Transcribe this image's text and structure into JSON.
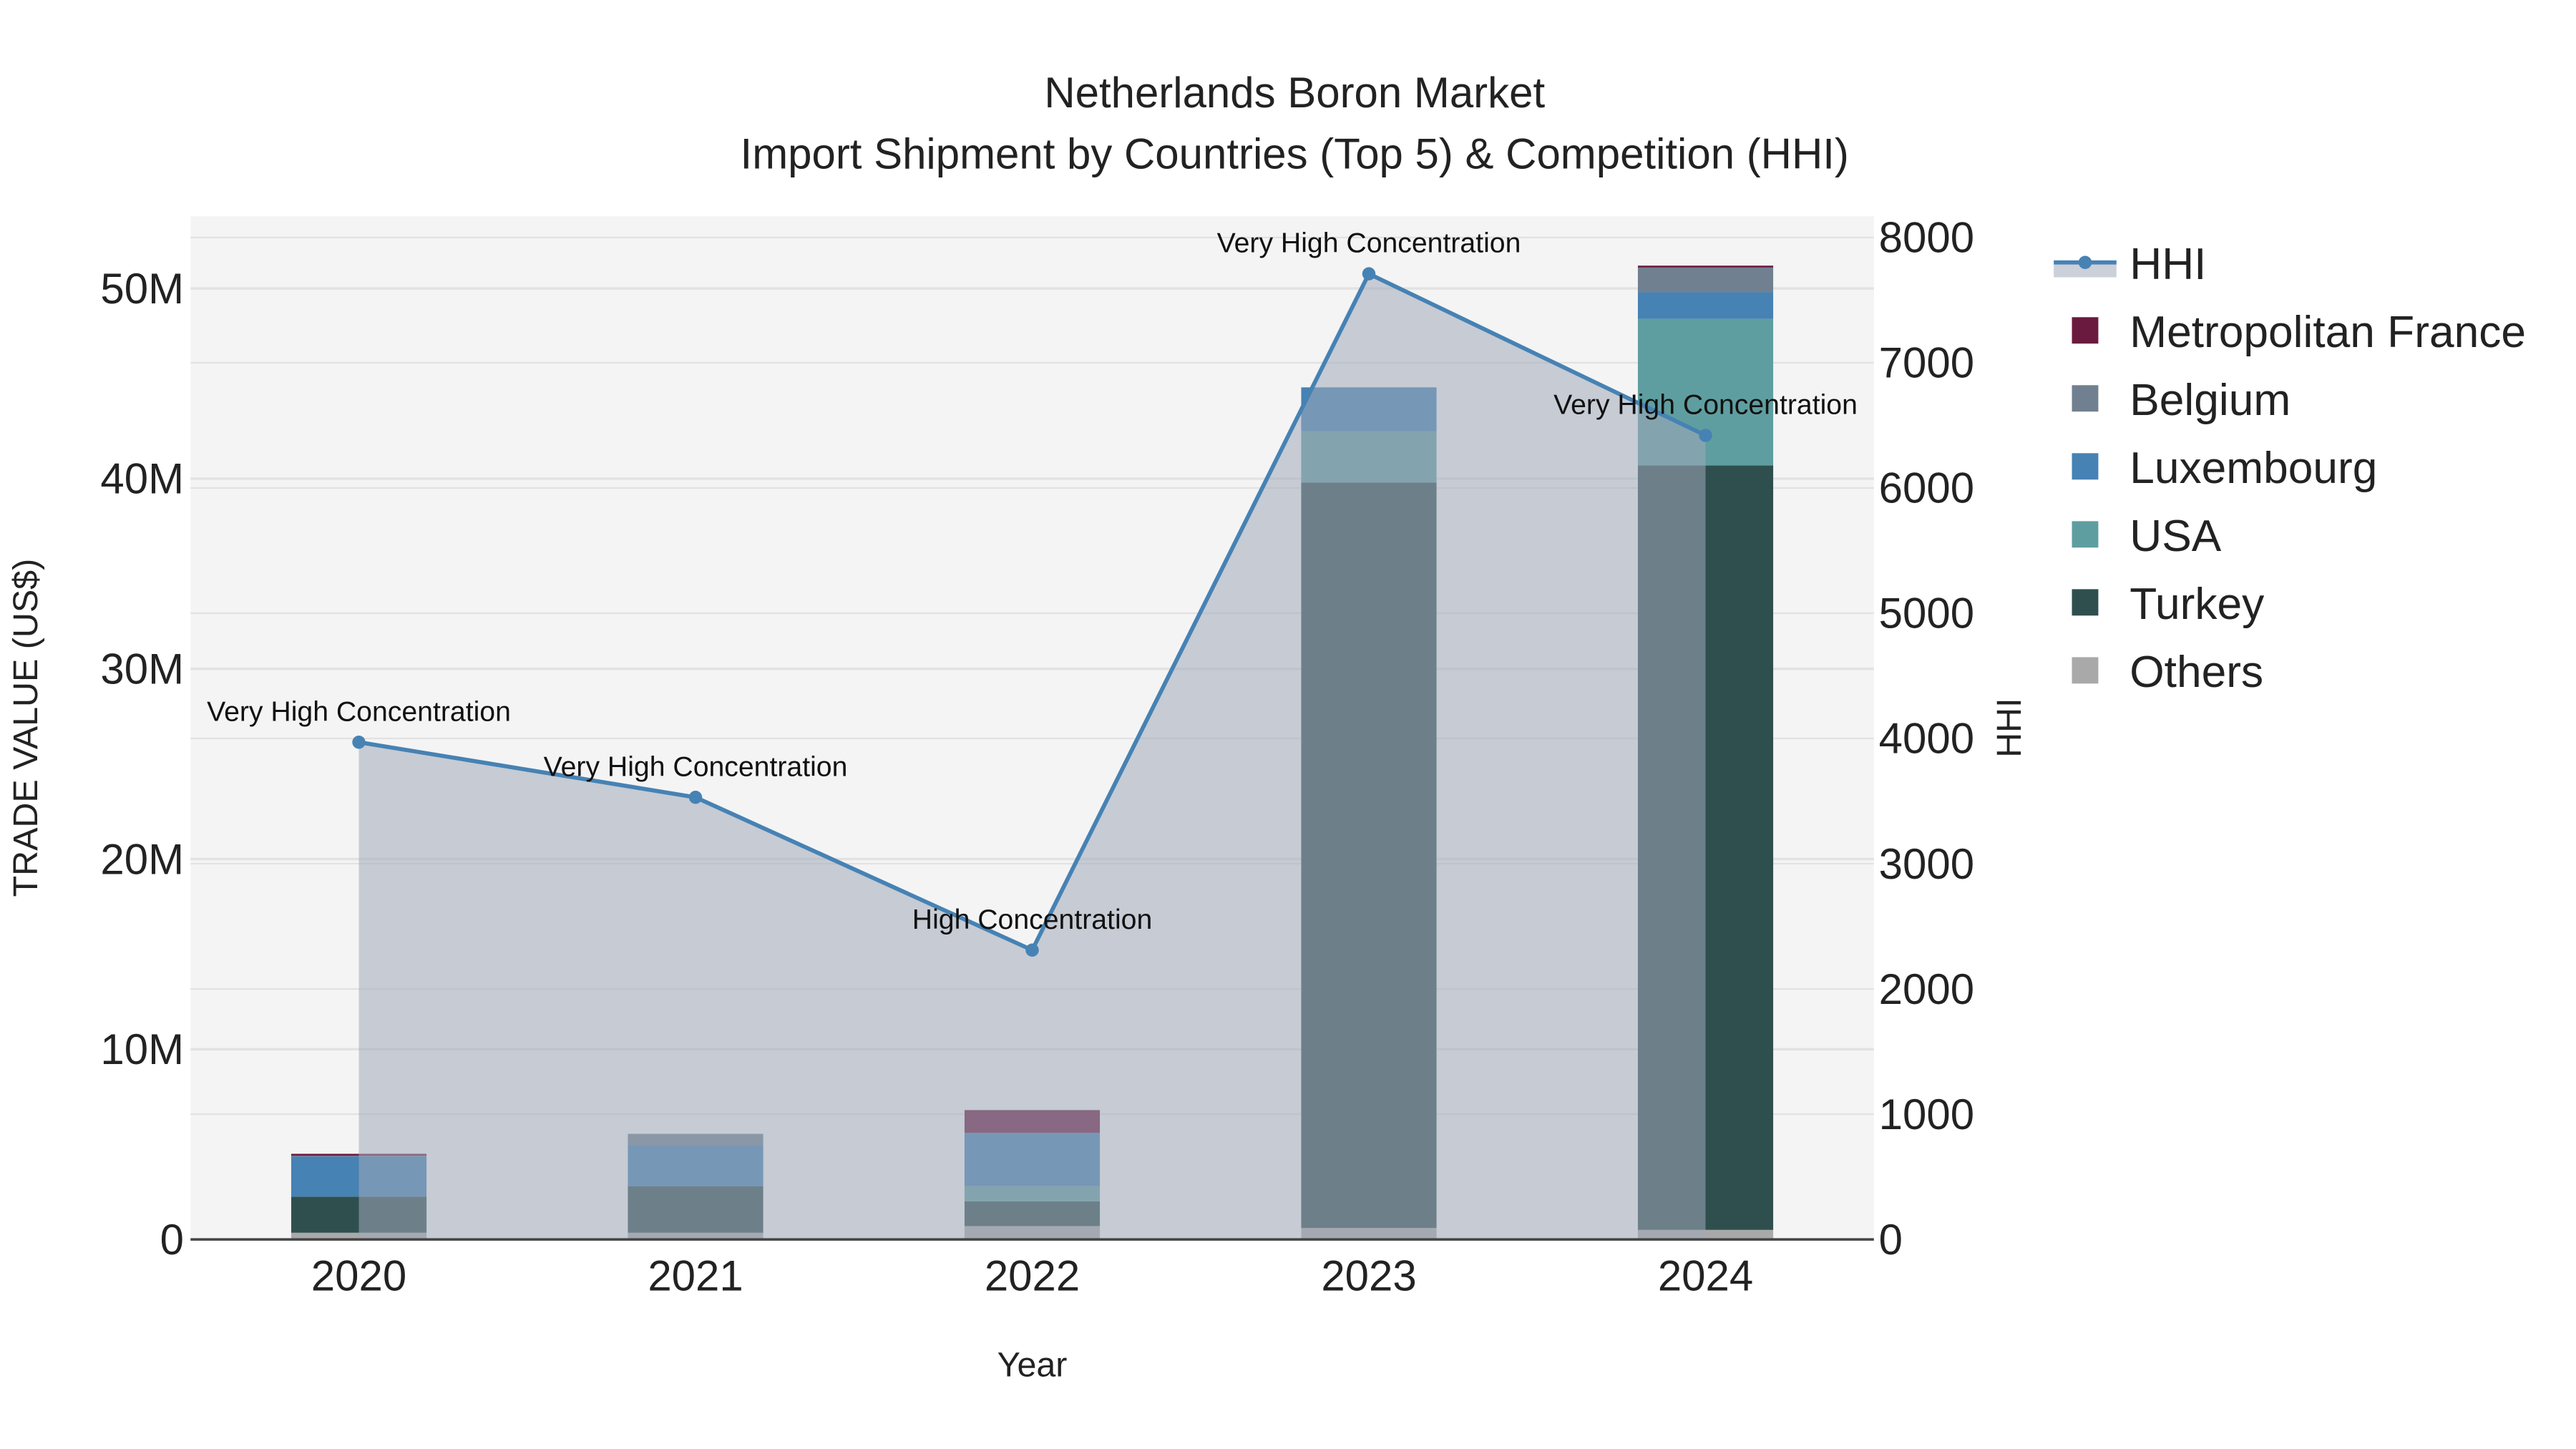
{
  "chart_data": {
    "type": "bar",
    "barmode": "stack",
    "title": "Netherlands Boron Market",
    "subtitle": "Import Shipment by Countries (Top 5) & Competition (HHI)",
    "xlabel": "Year",
    "ylabel": "TRADE VALUE (US$)",
    "y2label": "HHI",
    "categories": [
      "2020",
      "2021",
      "2022",
      "2023",
      "2024"
    ],
    "ylim": [
      0,
      53800000
    ],
    "y2lim": [
      0,
      8170
    ],
    "yticks": [
      {
        "v": 0,
        "label": "0"
      },
      {
        "v": 10000000,
        "label": "10M"
      },
      {
        "v": 20000000,
        "label": "20M"
      },
      {
        "v": 30000000,
        "label": "30M"
      },
      {
        "v": 40000000,
        "label": "40M"
      },
      {
        "v": 50000000,
        "label": "50M"
      }
    ],
    "y2ticks": [
      {
        "v": 0,
        "label": "0"
      },
      {
        "v": 1000,
        "label": "1000"
      },
      {
        "v": 2000,
        "label": "2000"
      },
      {
        "v": 3000,
        "label": "3000"
      },
      {
        "v": 4000,
        "label": "4000"
      },
      {
        "v": 5000,
        "label": "5000"
      },
      {
        "v": 6000,
        "label": "6000"
      },
      {
        "v": 7000,
        "label": "7000"
      },
      {
        "v": 8000,
        "label": "8000"
      }
    ],
    "grid": true,
    "legend_position": "right",
    "series": [
      {
        "name": "Others",
        "color": "#a9a9a9",
        "values": [
          350000,
          350000,
          700000,
          600000,
          500000
        ]
      },
      {
        "name": "Turkey",
        "color": "#2f4f4f",
        "values": [
          1900000,
          2450000,
          1300000,
          39200000,
          40200000
        ]
      },
      {
        "name": "USA",
        "color": "#5f9ea0",
        "values": [
          0,
          0,
          800000,
          2700000,
          7700000
        ]
      },
      {
        "name": "Luxembourg",
        "color": "#4682b4",
        "values": [
          2100000,
          2150000,
          2800000,
          2300000,
          1400000
        ]
      },
      {
        "name": "Belgium",
        "color": "#708090",
        "values": [
          50000,
          600000,
          0,
          0,
          1300000
        ]
      },
      {
        "name": "Metropolitan France",
        "color": "#6b1a3f",
        "values": [
          100000,
          0,
          1200000,
          0,
          100000
        ]
      }
    ],
    "hhi": {
      "name": "HHI",
      "color": "#4682b4",
      "values": [
        3970,
        3530,
        2310,
        7710,
        6420
      ],
      "annotations": [
        "Very High Concentration",
        "Very High Concentration",
        "High Concentration",
        "Very High Concentration",
        "Very High Concentration"
      ]
    },
    "legend_order": [
      "HHI",
      "Metropolitan France",
      "Belgium",
      "Luxembourg",
      "USA",
      "Turkey",
      "Others"
    ]
  }
}
